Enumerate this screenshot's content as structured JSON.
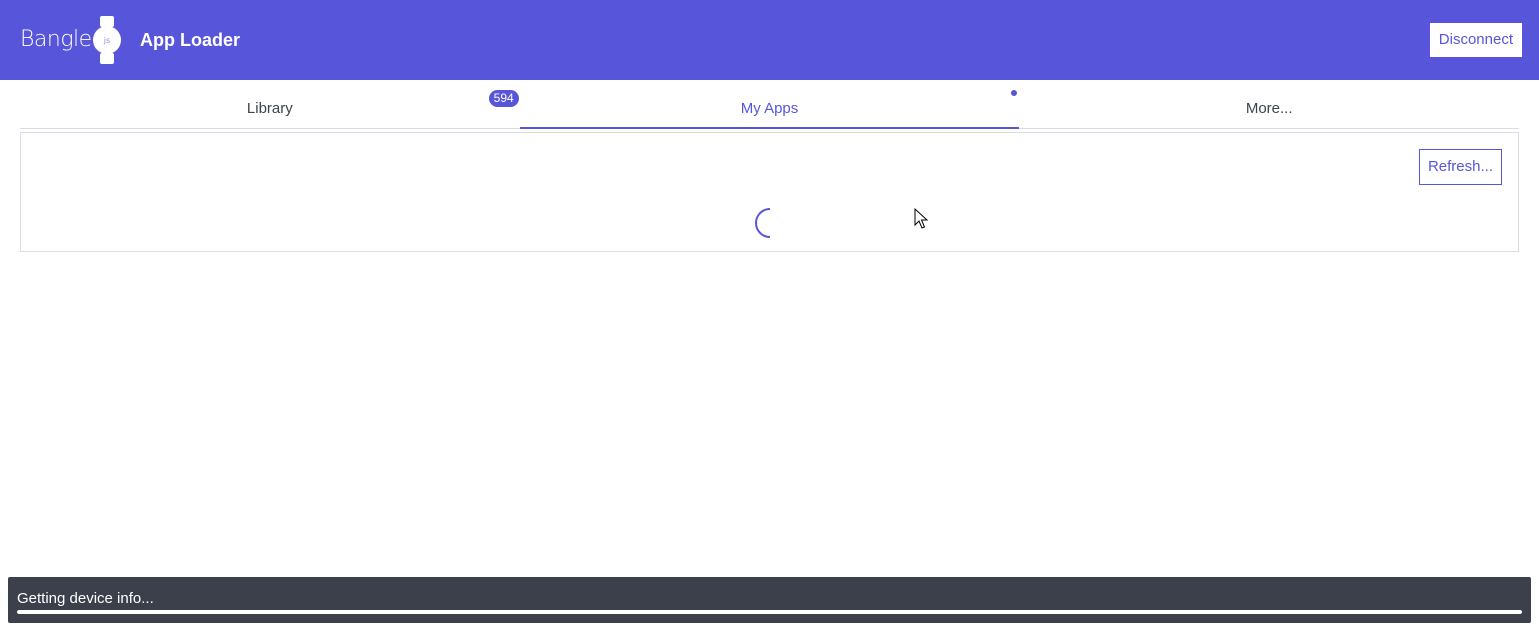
{
  "header": {
    "logo_text": "Bangle",
    "logo_sub": "js",
    "title": "App Loader",
    "disconnect_label": "Disconnect",
    "background_color": "#5755d9"
  },
  "tabs": [
    {
      "label": "Library",
      "badge": "594",
      "active": false
    },
    {
      "label": "My Apps",
      "active": true,
      "indicator": "dot"
    },
    {
      "label": "More...",
      "active": false
    }
  ],
  "my_apps": {
    "refresh_label": "Refresh...",
    "loading": true,
    "loading_icon": "spinner-icon"
  },
  "status": {
    "text": "Getting device info...",
    "progress": 1.0
  },
  "colors": {
    "accent": "#5755d9",
    "status_bg": "#3b404b",
    "border": "#dadee4"
  }
}
